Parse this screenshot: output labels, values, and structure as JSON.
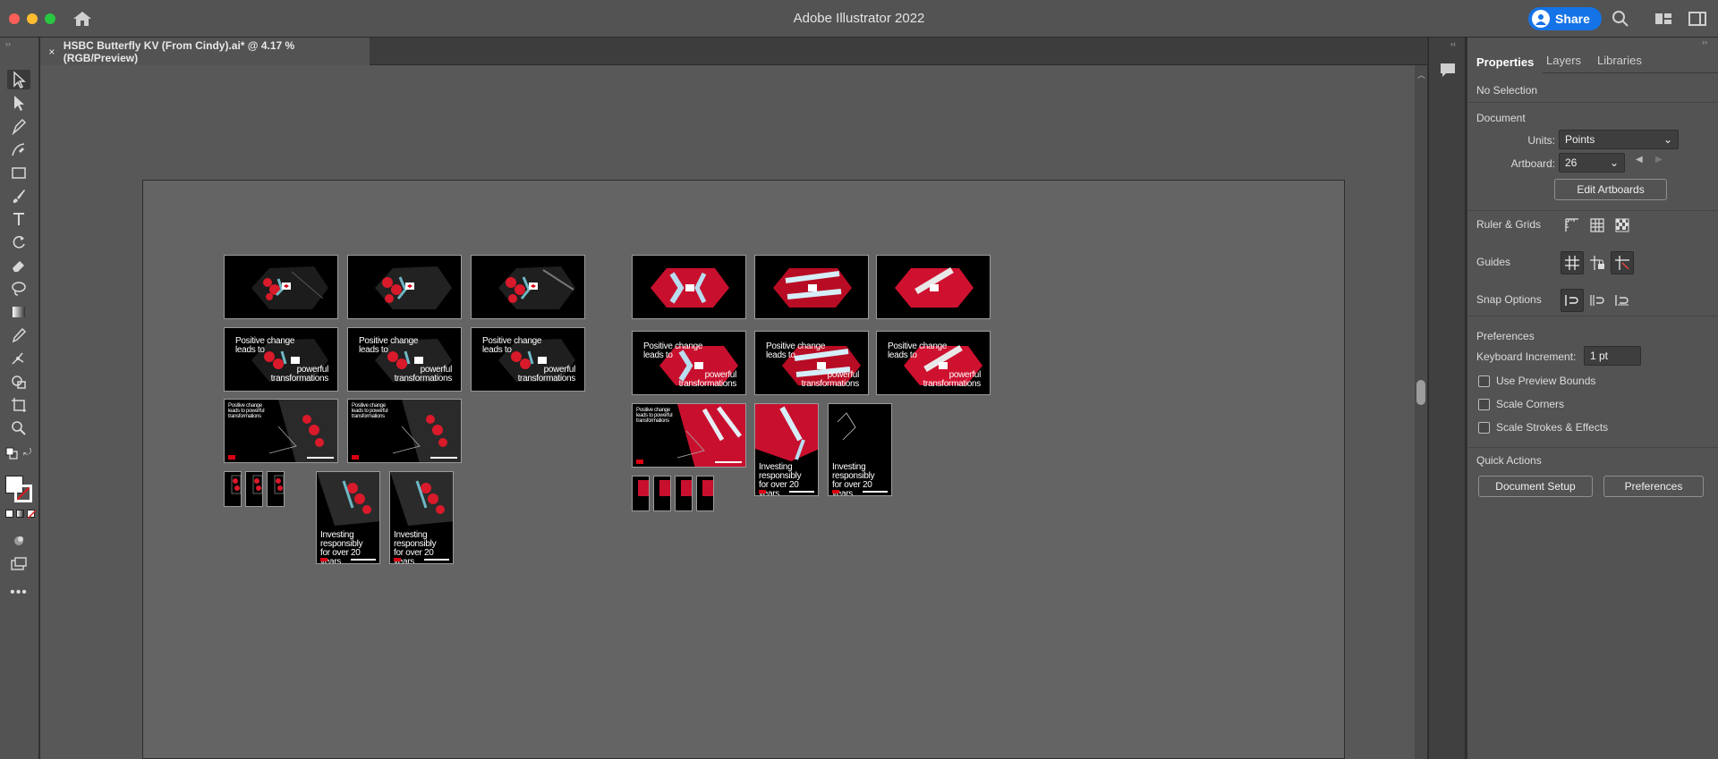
{
  "window": {
    "app_title": "Adobe Illustrator 2022",
    "share_label": "Share"
  },
  "document": {
    "tab_title": "HSBC Butterfly KV (From Cindy).ai* @ 4.17 % (RGB/Preview)",
    "zoom_percent": 4.17
  },
  "tools": [
    "selection-tool",
    "direct-selection-tool",
    "pen-tool",
    "curvature-tool",
    "rectangle-tool",
    "paintbrush-tool",
    "type-tool",
    "rotate-tool",
    "eraser-tool",
    "lasso-tool",
    "gradient-tool",
    "eyedropper-tool",
    "puppet-warp-tool",
    "shape-builder-tool",
    "artboard-tool",
    "zoom-tool"
  ],
  "artwork_text": {
    "headline_line1": "Positive change",
    "headline_line2": "leads to",
    "headline_line3": "powerful",
    "headline_line4": "transformations",
    "small_headline": "Positive change leads to powerful transformations",
    "investing_line1": "Investing",
    "investing_line2": "responsibly",
    "investing_line3": "for over 20 years"
  },
  "panel": {
    "tabs": [
      "Properties",
      "Layers",
      "Libraries"
    ],
    "active_tab": "Properties",
    "selection_state": "No Selection",
    "document_section": "Document",
    "units_label": "Units:",
    "units_value": "Points",
    "artboard_label": "Artboard:",
    "artboard_value": "26",
    "edit_artboards_label": "Edit Artboards",
    "ruler_grids_label": "Ruler & Grids",
    "guides_label": "Guides",
    "snap_options_label": "Snap Options",
    "preferences_section": "Preferences",
    "keyboard_increment_label": "Keyboard Increment:",
    "keyboard_increment_value": "1 pt",
    "use_preview_bounds_label": "Use Preview Bounds",
    "scale_corners_label": "Scale Corners",
    "scale_strokes_label": "Scale Strokes & Effects",
    "use_preview_bounds_checked": false,
    "scale_corners_checked": false,
    "scale_strokes_checked": false,
    "quick_actions_label": "Quick Actions",
    "document_setup_label": "Document Setup",
    "preferences_button_label": "Preferences"
  },
  "colors": {
    "accent_blue": "#1473e6",
    "hsbc_red": "#db0011",
    "artwork_red": "#d81a2a"
  }
}
